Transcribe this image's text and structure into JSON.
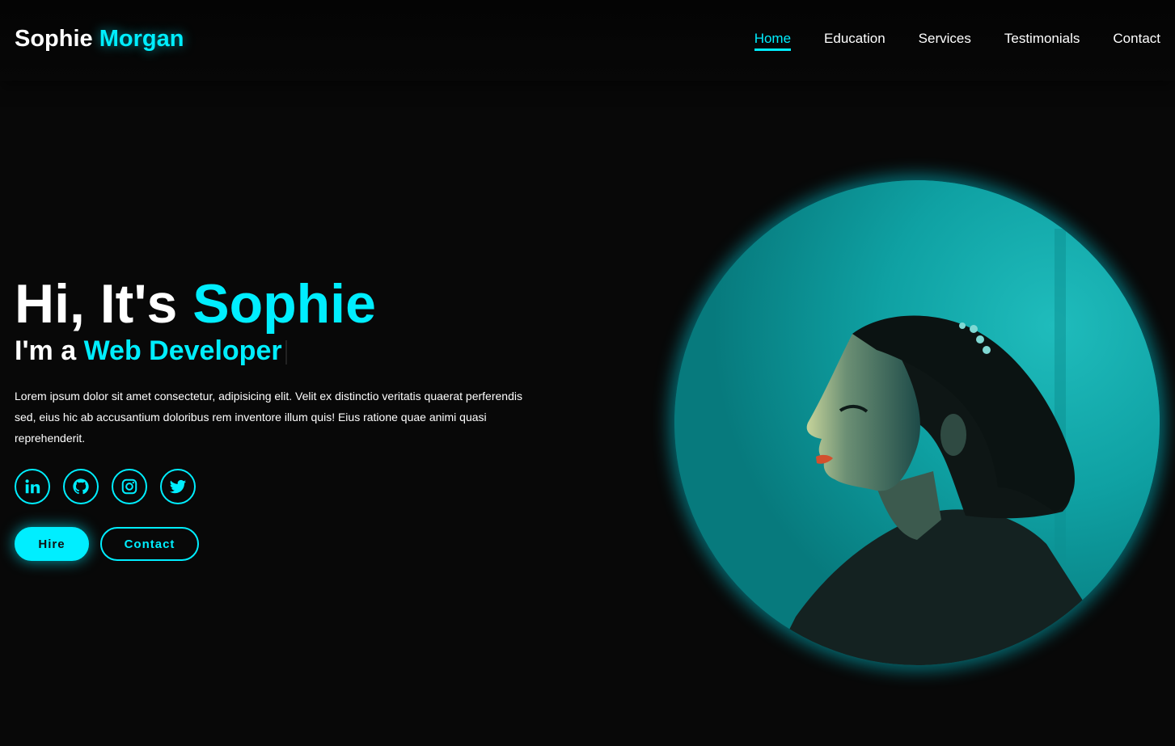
{
  "header": {
    "logo_first": "Sophie",
    "logo_last": "Morgan",
    "nav": [
      {
        "label": "Home",
        "active": true
      },
      {
        "label": "Education",
        "active": false
      },
      {
        "label": "Services",
        "active": false
      },
      {
        "label": "Testimonials",
        "active": false
      },
      {
        "label": "Contact",
        "active": false
      }
    ]
  },
  "hero": {
    "greeting_prefix": "Hi, It's",
    "greeting_name": "Sophie",
    "role_prefix": "I'm a",
    "role_title": "Web Developer",
    "description": "Lorem ipsum dolor sit amet consectetur, adipisicing elit. Velit ex distinctio veritatis quaerat perferendis sed, eius hic ab accusantium doloribus rem inventore illum quis! Eius ratione quae animi quasi reprehenderit.",
    "socials": [
      "linkedin-icon",
      "github-icon",
      "instagram-icon",
      "twitter-icon"
    ],
    "buttons": {
      "hire": "Hire",
      "contact": "Contact"
    }
  },
  "colors": {
    "accent": "#00eeff",
    "background": "#080808",
    "text": "#ffffff"
  }
}
